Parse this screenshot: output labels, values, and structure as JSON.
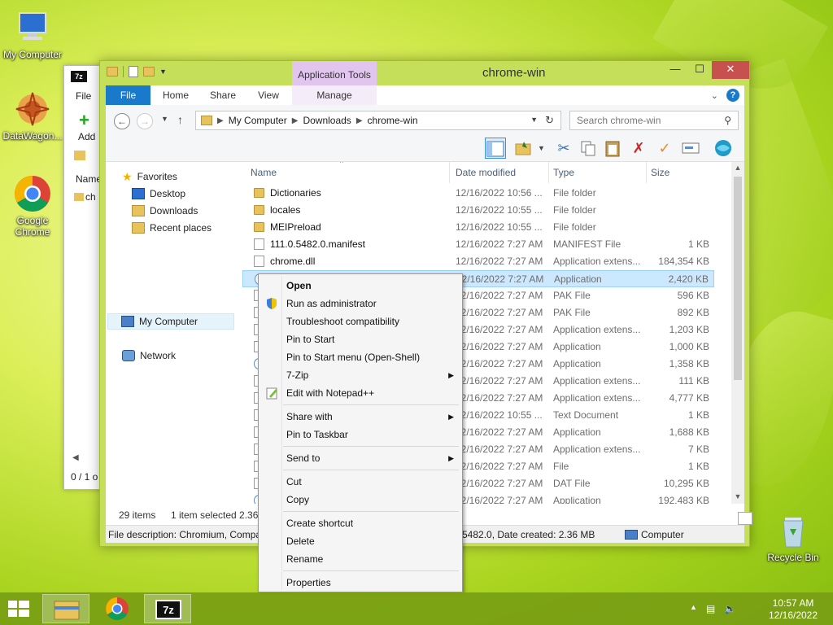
{
  "desktop": {
    "icons": [
      {
        "label": "My Computer"
      },
      {
        "label": "DataWagon..."
      },
      {
        "label": "Google Chrome"
      },
      {
        "label": "Recycle Bin"
      }
    ]
  },
  "sevenzip_window": {
    "menu_file": "File",
    "add_label": "Add",
    "col_name": "Name",
    "item_prefix": "ch",
    "status": "0 / 1 o"
  },
  "explorer": {
    "title": "chrome-win",
    "app_tools": "Application Tools",
    "tabs": [
      "File",
      "Home",
      "Share",
      "View",
      "Manage"
    ],
    "address": {
      "crumbs": [
        "My Computer",
        "Downloads",
        "chrome-win"
      ]
    },
    "search_placeholder": "Search chrome-win",
    "nav": {
      "favorites": "Favorites",
      "desktop": "Desktop",
      "downloads": "Downloads",
      "recent": "Recent places",
      "my_computer": "My Computer",
      "network": "Network"
    },
    "columns": {
      "name": "Name",
      "date": "Date modified",
      "type": "Type",
      "size": "Size"
    },
    "files": [
      {
        "name": "Dictionaries",
        "date": "12/16/2022 10:56 ...",
        "type": "File folder",
        "size": "",
        "icon": "folder"
      },
      {
        "name": "locales",
        "date": "12/16/2022 10:55 ...",
        "type": "File folder",
        "size": "",
        "icon": "folder"
      },
      {
        "name": "MEIPreload",
        "date": "12/16/2022 10:55 ...",
        "type": "File folder",
        "size": "",
        "icon": "folder"
      },
      {
        "name": "111.0.5482.0.manifest",
        "date": "12/16/2022 7:27 AM",
        "type": "MANIFEST File",
        "size": "1 KB",
        "icon": "doc"
      },
      {
        "name": "chrome.dll",
        "date": "12/16/2022 7:27 AM",
        "type": "Application extens...",
        "size": "184,354 KB",
        "icon": "doc"
      },
      {
        "name": "",
        "date": "12/16/2022 7:27 AM",
        "type": "Application",
        "size": "2,420 KB",
        "icon": "app",
        "selected": true
      },
      {
        "name": "",
        "date": "12/16/2022 7:27 AM",
        "type": "PAK File",
        "size": "596 KB",
        "icon": "doc"
      },
      {
        "name": "",
        "date": "12/16/2022 7:27 AM",
        "type": "PAK File",
        "size": "892 KB",
        "icon": "doc"
      },
      {
        "name": "",
        "date": "12/16/2022 7:27 AM",
        "type": "Application extens...",
        "size": "1,203 KB",
        "icon": "doc"
      },
      {
        "name": "",
        "date": "12/16/2022 7:27 AM",
        "type": "Application",
        "size": "1,000 KB",
        "icon": "doc"
      },
      {
        "name": "",
        "date": "12/16/2022 7:27 AM",
        "type": "Application",
        "size": "1,358 KB",
        "icon": "app"
      },
      {
        "name": "",
        "date": "12/16/2022 7:27 AM",
        "type": "Application extens...",
        "size": "111 KB",
        "icon": "doc"
      },
      {
        "name": "",
        "date": "12/16/2022 7:27 AM",
        "type": "Application extens...",
        "size": "4,777 KB",
        "icon": "doc"
      },
      {
        "name": "",
        "date": "12/16/2022 10:55 ...",
        "type": "Text Document",
        "size": "1 KB",
        "icon": "doc"
      },
      {
        "name": "",
        "date": "12/16/2022 7:27 AM",
        "type": "Application",
        "size": "1,688 KB",
        "icon": "doc"
      },
      {
        "name": "",
        "date": "12/16/2022 7:27 AM",
        "type": "Application extens...",
        "size": "7 KB",
        "icon": "doc"
      },
      {
        "name": "",
        "date": "12/16/2022 7:27 AM",
        "type": "File",
        "size": "1 KB",
        "icon": "doc"
      },
      {
        "name": "",
        "date": "12/16/2022 7:27 AM",
        "type": "DAT File",
        "size": "10,295 KB",
        "icon": "doc"
      },
      {
        "name": "",
        "date": "12/16/2022 7:27 AM",
        "type": "Application",
        "size": "192,483 KB",
        "icon": "app"
      }
    ],
    "status": {
      "items": "29 items",
      "selected": "1 item selected  2.36"
    },
    "descbar": {
      "left": "File description: Chromium, Compa",
      "middle": "5482.0, Date created: 2.36 MB",
      "right": "Computer"
    }
  },
  "context_menu": {
    "items": [
      {
        "label": "Open",
        "bold": true
      },
      {
        "label": "Run as administrator",
        "icon": "shield"
      },
      {
        "label": "Troubleshoot compatibility"
      },
      {
        "label": "Pin to Start"
      },
      {
        "label": "Pin to Start menu (Open-Shell)"
      },
      {
        "label": "7-Zip",
        "submenu": true
      },
      {
        "label": "Edit with Notepad++",
        "icon": "notepad"
      },
      {
        "label": "Share with",
        "submenu": true
      },
      {
        "label": "Pin to Taskbar"
      },
      {
        "label": "Send to",
        "submenu": true
      },
      {
        "label": "Cut"
      },
      {
        "label": "Copy"
      },
      {
        "label": "Create shortcut"
      },
      {
        "label": "Delete"
      },
      {
        "label": "Rename"
      },
      {
        "label": "Properties"
      }
    ]
  },
  "taskbar": {
    "time": "10:57 AM",
    "date": "12/16/2022",
    "apps": [
      "File Explorer",
      "Google Chrome",
      "7-Zip"
    ]
  }
}
